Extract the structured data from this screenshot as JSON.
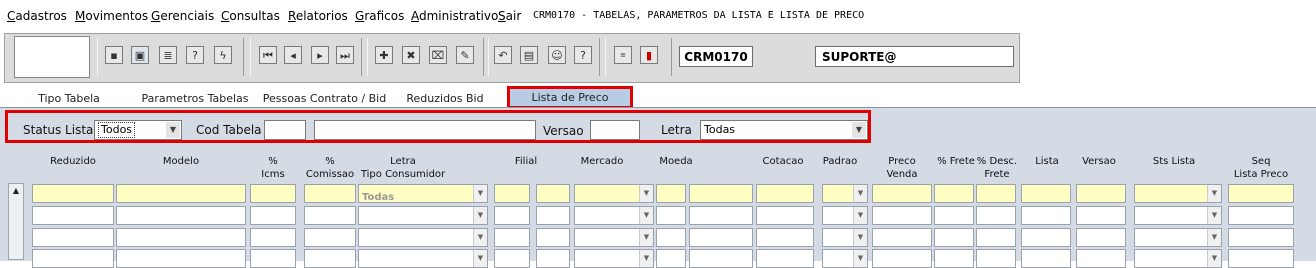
{
  "menu": {
    "items": [
      "Cadastros",
      "Movimentos",
      "Gerenciais",
      "Consultas",
      "Relatorios",
      "Graficos",
      "Administrativo",
      "Sair"
    ],
    "form_title": "CRM0170 - TABELAS, PARAMETROS DA LISTA E LISTA DE PRECO"
  },
  "toolbar": {
    "form_code": "CRM0170",
    "user": "SUPORTE@"
  },
  "tabs": [
    "Tipo Tabela",
    "Parametros Tabelas",
    "Pessoas Contrato / Bid",
    "Reduzidos Bid",
    "Lista de Preco"
  ],
  "filter": {
    "status_label": "Status Lista",
    "status_value": "Todos",
    "cod_label": "Cod Tabela",
    "versao_label": "Versao",
    "letra_label": "Letra",
    "letra_value": "Todas"
  },
  "grid": {
    "headers": [
      {
        "l1": "",
        "l2": "Reduzido"
      },
      {
        "l1": "",
        "l2": "Modelo"
      },
      {
        "l1": "%",
        "l2": "Icms"
      },
      {
        "l1": "%",
        "l2": "Comissao"
      },
      {
        "l1": "Letra",
        "l2": "Tipo Consumidor"
      },
      {
        "l1": "",
        "l2": "Filial"
      },
      {
        "l1": "",
        "l2": "Mercado"
      },
      {
        "l1": "",
        "l2": "Moeda"
      },
      {
        "l1": "",
        "l2": "Cotacao"
      },
      {
        "l1": "",
        "l2": "Padrao"
      },
      {
        "l1": "Preco",
        "l2": "Venda"
      },
      {
        "l1": "",
        "l2": "% Frete"
      },
      {
        "l1": "% Desc.",
        "l2": "Frete"
      },
      {
        "l1": "",
        "l2": "Lista"
      },
      {
        "l1": "",
        "l2": "Versao"
      },
      {
        "l1": "",
        "l2": "Sts Lista"
      },
      {
        "l1": "Seq",
        "l2": "Lista Preco"
      }
    ],
    "first_row_tipo_consumidor": "Todas"
  }
}
